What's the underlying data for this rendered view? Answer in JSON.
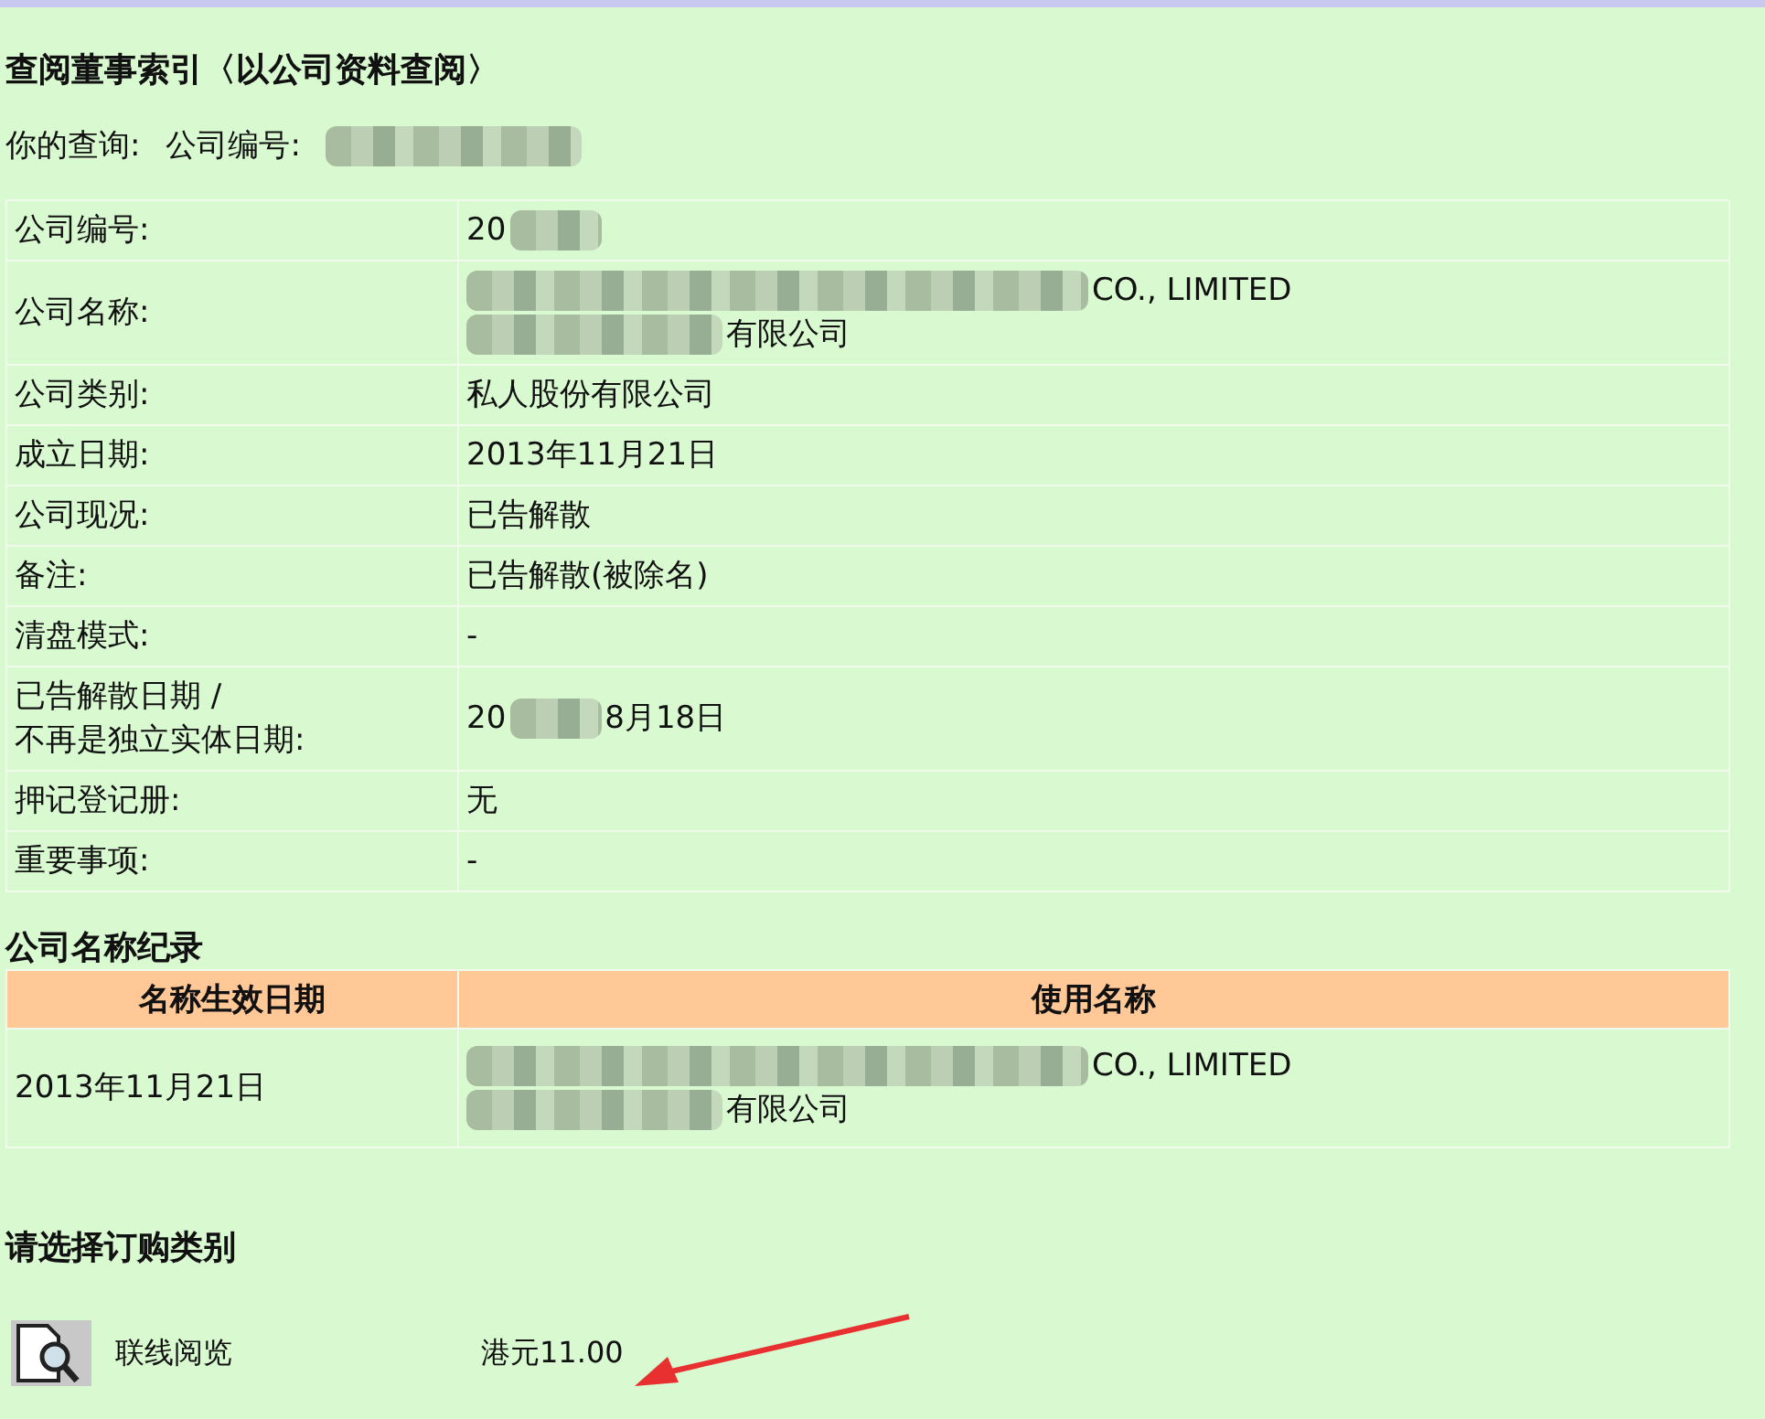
{
  "title": "查阅董事索引〈以公司资料查阅〉",
  "query": {
    "label": "你的查询:",
    "field": "公司编号:",
    "value": [
      {
        "kind": "mosaic"
      }
    ]
  },
  "details": [
    {
      "label": "公司编号:",
      "lines": [
        [
          {
            "kind": "text",
            "text": "20"
          },
          {
            "kind": "blot"
          }
        ]
      ]
    },
    {
      "label": "公司名称:",
      "lines": [
        [
          {
            "kind": "band"
          },
          {
            "kind": "text",
            "text": "CO., LIMITED"
          }
        ],
        [
          {
            "kind": "mosaic"
          },
          {
            "kind": "text",
            "text": "有限公司"
          }
        ]
      ]
    },
    {
      "label": "公司类别:",
      "lines": [
        [
          {
            "kind": "text",
            "text": "私人股份有限公司"
          }
        ]
      ]
    },
    {
      "label": "成立日期:",
      "lines": [
        [
          {
            "kind": "text",
            "text": "2013年11月21日"
          }
        ]
      ]
    },
    {
      "label": "公司现况:",
      "lines": [
        [
          {
            "kind": "text",
            "text": "已告解散"
          }
        ]
      ]
    },
    {
      "label": "备注:",
      "lines": [
        [
          {
            "kind": "text",
            "text": "已告解散(被除名)"
          }
        ]
      ]
    },
    {
      "label": "清盘模式:",
      "lines": [
        [
          {
            "kind": "text",
            "text": "-"
          }
        ]
      ]
    },
    {
      "label": "已告解散日期 /\n不再是独立实体日期:",
      "lines": [
        [
          {
            "kind": "text",
            "text": "20"
          },
          {
            "kind": "blot"
          },
          {
            "kind": "text",
            "text": "8月18日"
          }
        ]
      ]
    },
    {
      "label": "押记登记册:",
      "lines": [
        [
          {
            "kind": "text",
            "text": "无"
          }
        ]
      ]
    },
    {
      "label": "重要事项:",
      "lines": [
        [
          {
            "kind": "text",
            "text": "-"
          }
        ]
      ]
    }
  ],
  "name_history": {
    "title": "公司名称纪录",
    "columns": [
      "名称生效日期",
      "使用名称"
    ],
    "rows": [
      {
        "date": "2013年11月21日",
        "lines": [
          [
            {
              "kind": "band"
            },
            {
              "kind": "text",
              "text": "CO., LIMITED"
            }
          ],
          [
            {
              "kind": "mosaic"
            },
            {
              "kind": "text",
              "text": "有限公司"
            }
          ]
        ]
      }
    ]
  },
  "order": {
    "title": "请选择订购类别",
    "items": [
      {
        "label": "联线阅览",
        "price": "港元11.00"
      }
    ]
  }
}
